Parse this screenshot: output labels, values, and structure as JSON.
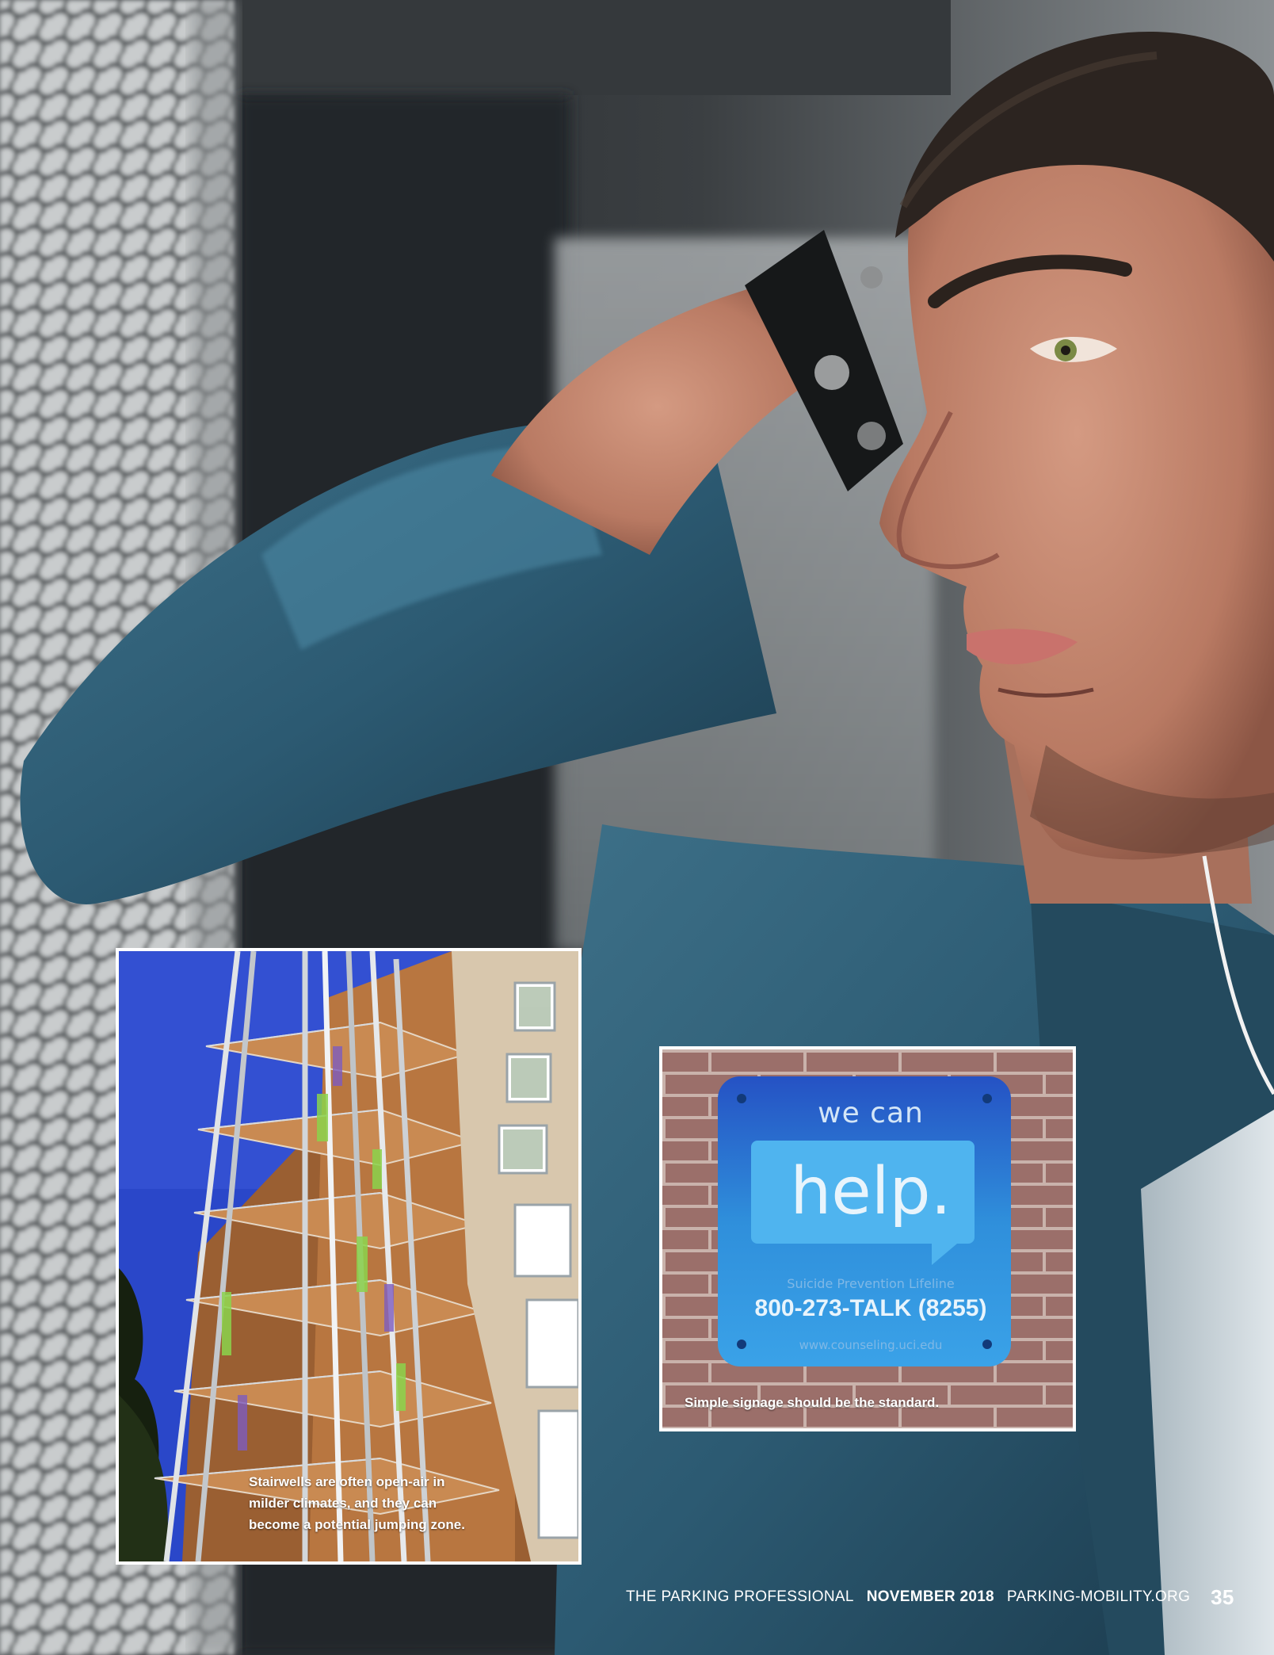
{
  "photos": {
    "stairwell": {
      "caption": "Stairwells are often open-air in milder climates, and they can become a potential jumping zone."
    },
    "signage": {
      "caption": "Simple signage should be the standard.",
      "sign": {
        "top_text": "we can",
        "main_text": "help.",
        "lifeline": "Suicide Prevention Lifeline",
        "phone": "800-273-TALK (8255)",
        "url": "www.counseling.uci.edu"
      }
    }
  },
  "footer": {
    "publication": "THE PARKING PROFESSIONAL",
    "issue": "NOVEMBER 2018",
    "website": "PARKING-MOBILITY.ORG",
    "page_number": "35"
  },
  "colors": {
    "sign_blue": "#2f8fdb",
    "sky_blue": "#2a47c9",
    "denim": "#2c5a72"
  }
}
